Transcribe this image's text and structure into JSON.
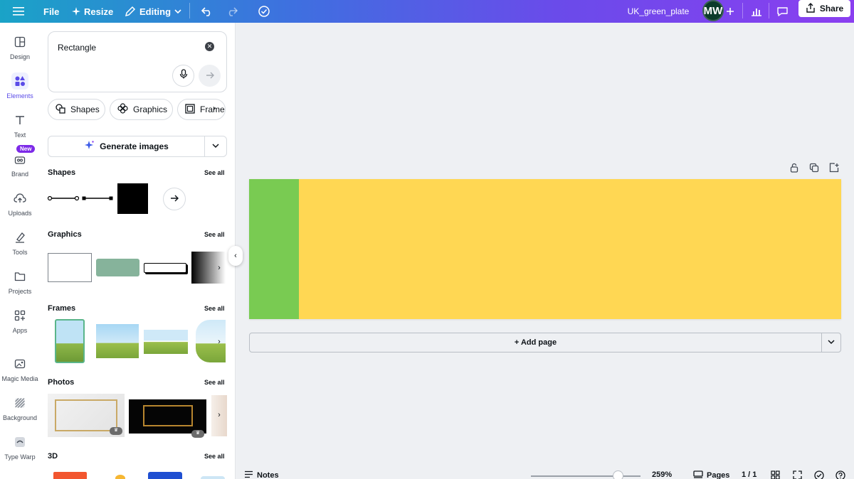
{
  "topbar": {
    "file_label": "File",
    "resize_label": "Resize",
    "mode_label": "Editing",
    "doc_title": "UK_green_plate",
    "avatar_initials": "MW",
    "share_label": "Share"
  },
  "rail": {
    "items": [
      {
        "label": "Design"
      },
      {
        "label": "Elements"
      },
      {
        "label": "Text"
      },
      {
        "label": "Brand"
      },
      {
        "label": "Uploads"
      },
      {
        "label": "Tools"
      },
      {
        "label": "Projects"
      },
      {
        "label": "Apps"
      },
      {
        "label": "Magic Media"
      },
      {
        "label": "Background"
      },
      {
        "label": "Type Warp"
      }
    ],
    "new_badge": "New",
    "active_index": 1
  },
  "panel": {
    "search_value": "Rectangle",
    "chips": [
      {
        "label": "Shapes"
      },
      {
        "label": "Graphics"
      },
      {
        "label": "Frames"
      }
    ],
    "generate_label": "Generate images",
    "see_all": "See all",
    "sections": {
      "shapes": "Shapes",
      "graphics": "Graphics",
      "frames": "Frames",
      "photos": "Photos",
      "three_d": "3D"
    }
  },
  "canvas": {
    "add_page_label": "+ Add page",
    "colors": {
      "background": "#ffd753",
      "rectangle": "#79cb52"
    }
  },
  "bottombar": {
    "notes_label": "Notes",
    "zoom": "259%",
    "pages_label": "Pages",
    "page_count": "1 / 1"
  }
}
